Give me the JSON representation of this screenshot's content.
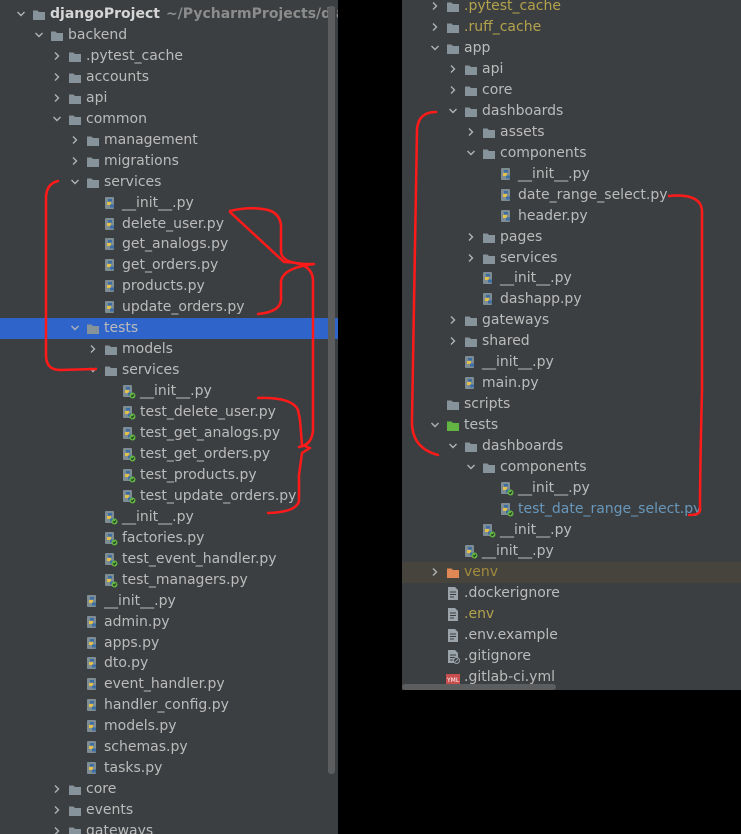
{
  "left_tree": [
    {
      "label": "djangoProject",
      "path": "~/PycharmProjects/djangoP",
      "type": "folder",
      "expanded": true,
      "depth": 0,
      "bold": true,
      "icon": "folder-icon"
    },
    {
      "label": "backend",
      "type": "folder",
      "expanded": true,
      "depth": 1,
      "icon": "folder-icon"
    },
    {
      "label": ".pytest_cache",
      "type": "folder",
      "expanded": false,
      "depth": 2,
      "icon": "folder-icon"
    },
    {
      "label": "accounts",
      "type": "folder",
      "expanded": false,
      "depth": 2,
      "icon": "folder-icon"
    },
    {
      "label": "api",
      "type": "folder",
      "expanded": false,
      "depth": 2,
      "icon": "folder-icon"
    },
    {
      "label": "common",
      "type": "folder",
      "expanded": true,
      "depth": 2,
      "icon": "folder-icon"
    },
    {
      "label": "management",
      "type": "folder",
      "expanded": false,
      "depth": 3,
      "icon": "folder-icon"
    },
    {
      "label": "migrations",
      "type": "folder",
      "expanded": false,
      "depth": 3,
      "icon": "folder-icon"
    },
    {
      "label": "services",
      "type": "folder",
      "expanded": true,
      "depth": 3,
      "icon": "folder-icon"
    },
    {
      "label": "__init__.py",
      "type": "python",
      "depth": 4,
      "icon": "python-file-icon"
    },
    {
      "label": "delete_user.py",
      "type": "python",
      "depth": 4,
      "icon": "python-file-icon"
    },
    {
      "label": "get_analogs.py",
      "type": "python",
      "depth": 4,
      "icon": "python-file-icon"
    },
    {
      "label": "get_orders.py",
      "type": "python",
      "depth": 4,
      "icon": "python-file-icon"
    },
    {
      "label": "products.py",
      "type": "python",
      "depth": 4,
      "icon": "python-file-icon"
    },
    {
      "label": "update_orders.py",
      "type": "python",
      "depth": 4,
      "icon": "python-file-icon"
    },
    {
      "label": "tests",
      "type": "folder",
      "expanded": true,
      "depth": 3,
      "selected": true,
      "icon": "folder-icon"
    },
    {
      "label": "models",
      "type": "folder",
      "expanded": false,
      "depth": 4,
      "icon": "folder-icon"
    },
    {
      "label": "services",
      "type": "folder",
      "expanded": true,
      "depth": 4,
      "icon": "folder-icon"
    },
    {
      "label": "__init__.py",
      "type": "python-test",
      "depth": 5,
      "icon": "python-test-file-icon"
    },
    {
      "label": "test_delete_user.py",
      "type": "python-test",
      "depth": 5,
      "icon": "python-test-file-icon"
    },
    {
      "label": "test_get_analogs.py",
      "type": "python-test",
      "depth": 5,
      "icon": "python-test-file-icon"
    },
    {
      "label": "test_get_orders.py",
      "type": "python-test",
      "depth": 5,
      "icon": "python-test-file-icon"
    },
    {
      "label": "test_products.py",
      "type": "python-test",
      "depth": 5,
      "icon": "python-test-file-icon"
    },
    {
      "label": "test_update_orders.py",
      "type": "python-test",
      "depth": 5,
      "icon": "python-test-file-icon"
    },
    {
      "label": "__init__.py",
      "type": "python-test",
      "depth": 4,
      "icon": "python-test-file-icon"
    },
    {
      "label": "factories.py",
      "type": "python-test",
      "depth": 4,
      "icon": "python-test-file-icon"
    },
    {
      "label": "test_event_handler.py",
      "type": "python-test",
      "depth": 4,
      "icon": "python-test-file-icon"
    },
    {
      "label": "test_managers.py",
      "type": "python-test",
      "depth": 4,
      "icon": "python-test-file-icon"
    },
    {
      "label": "__init__.py",
      "type": "python",
      "depth": 3,
      "icon": "python-file-icon"
    },
    {
      "label": "admin.py",
      "type": "python",
      "depth": 3,
      "icon": "python-file-icon"
    },
    {
      "label": "apps.py",
      "type": "python",
      "depth": 3,
      "icon": "python-file-icon"
    },
    {
      "label": "dto.py",
      "type": "python",
      "depth": 3,
      "icon": "python-file-icon"
    },
    {
      "label": "event_handler.py",
      "type": "python",
      "depth": 3,
      "icon": "python-file-icon"
    },
    {
      "label": "handler_config.py",
      "type": "python",
      "depth": 3,
      "icon": "python-file-icon"
    },
    {
      "label": "models.py",
      "type": "python",
      "depth": 3,
      "icon": "python-file-icon"
    },
    {
      "label": "schemas.py",
      "type": "python",
      "depth": 3,
      "icon": "python-file-icon"
    },
    {
      "label": "tasks.py",
      "type": "python",
      "depth": 3,
      "icon": "python-file-icon"
    },
    {
      "label": "core",
      "type": "folder",
      "expanded": false,
      "depth": 2,
      "icon": "folder-icon"
    },
    {
      "label": "events",
      "type": "folder",
      "expanded": false,
      "depth": 2,
      "icon": "folder-icon"
    },
    {
      "label": "gateways",
      "type": "folder",
      "expanded": false,
      "depth": 2,
      "icon": "folder-icon"
    }
  ],
  "right_tree": [
    {
      "label": ".pytest_cache",
      "type": "folder",
      "expanded": false,
      "depth": 1,
      "color": "yellow",
      "icon": "folder-icon"
    },
    {
      "label": ".ruff_cache",
      "type": "folder",
      "expanded": false,
      "depth": 1,
      "color": "yellow",
      "icon": "folder-icon"
    },
    {
      "label": "app",
      "type": "folder",
      "expanded": true,
      "depth": 1,
      "icon": "folder-icon"
    },
    {
      "label": "api",
      "type": "folder",
      "expanded": false,
      "depth": 2,
      "icon": "folder-icon"
    },
    {
      "label": "core",
      "type": "folder",
      "expanded": false,
      "depth": 2,
      "icon": "folder-icon"
    },
    {
      "label": "dashboards",
      "type": "folder",
      "expanded": true,
      "depth": 2,
      "icon": "folder-icon"
    },
    {
      "label": "assets",
      "type": "folder",
      "expanded": false,
      "depth": 3,
      "icon": "folder-icon"
    },
    {
      "label": "components",
      "type": "folder",
      "expanded": true,
      "depth": 3,
      "icon": "folder-icon"
    },
    {
      "label": "__init__.py",
      "type": "python",
      "depth": 4,
      "icon": "python-file-icon"
    },
    {
      "label": "date_range_select.py",
      "type": "python",
      "depth": 4,
      "icon": "python-file-icon"
    },
    {
      "label": "header.py",
      "type": "python",
      "depth": 4,
      "icon": "python-file-icon"
    },
    {
      "label": "pages",
      "type": "folder",
      "expanded": false,
      "depth": 3,
      "icon": "folder-icon"
    },
    {
      "label": "services",
      "type": "folder",
      "expanded": false,
      "depth": 3,
      "icon": "folder-icon"
    },
    {
      "label": "__init__.py",
      "type": "python",
      "depth": 3,
      "icon": "python-file-icon"
    },
    {
      "label": "dashapp.py",
      "type": "python",
      "depth": 3,
      "icon": "python-file-icon"
    },
    {
      "label": "gateways",
      "type": "folder",
      "expanded": false,
      "depth": 2,
      "icon": "folder-icon"
    },
    {
      "label": "shared",
      "type": "folder",
      "expanded": false,
      "depth": 2,
      "icon": "folder-icon"
    },
    {
      "label": "__init__.py",
      "type": "python",
      "depth": 2,
      "icon": "python-file-icon"
    },
    {
      "label": "main.py",
      "type": "python",
      "depth": 2,
      "icon": "python-file-icon"
    },
    {
      "label": "scripts",
      "type": "folder",
      "depth": 1,
      "icon": "folder-icon"
    },
    {
      "label": "tests",
      "type": "folder-test",
      "expanded": true,
      "depth": 1,
      "icon": "test-folder-icon"
    },
    {
      "label": "dashboards",
      "type": "folder",
      "expanded": true,
      "depth": 2,
      "icon": "folder-icon"
    },
    {
      "label": "components",
      "type": "folder",
      "expanded": true,
      "depth": 3,
      "icon": "folder-icon"
    },
    {
      "label": "__init__.py",
      "type": "python-test",
      "depth": 4,
      "icon": "python-test-file-icon"
    },
    {
      "label": "test_date_range_select.py",
      "type": "python-test",
      "depth": 4,
      "color": "blue",
      "icon": "python-test-file-icon"
    },
    {
      "label": "__init__.py",
      "type": "python-test",
      "depth": 3,
      "icon": "python-test-file-icon"
    },
    {
      "label": "__init__.py",
      "type": "python-test",
      "depth": 2,
      "icon": "python-test-file-icon"
    },
    {
      "label": "venv",
      "type": "folder-excluded",
      "expanded": false,
      "depth": 1,
      "color": "ignored",
      "highlight": true,
      "icon": "excluded-folder-icon"
    },
    {
      "label": ".dockerignore",
      "type": "text",
      "depth": 1,
      "icon": "dockerignore-file-icon"
    },
    {
      "label": ".env",
      "type": "text",
      "depth": 1,
      "color": "yellow",
      "icon": "env-file-icon"
    },
    {
      "label": ".env.example",
      "type": "text",
      "depth": 1,
      "icon": "text-file-icon"
    },
    {
      "label": ".gitignore",
      "type": "gitignore",
      "depth": 1,
      "icon": "gitignore-file-icon"
    },
    {
      "label": ".gitlab-ci.yml",
      "type": "yml",
      "depth": 1,
      "icon": "yml-file-icon"
    }
  ],
  "colors": {
    "panel_bg": "#3c3f41",
    "selection": "#2f65ca",
    "text": "#bbbbbb",
    "folder": "#87939a",
    "test_folder": "#62b543",
    "excluded_folder": "#e08855",
    "annotation": "#ff1a1a"
  }
}
